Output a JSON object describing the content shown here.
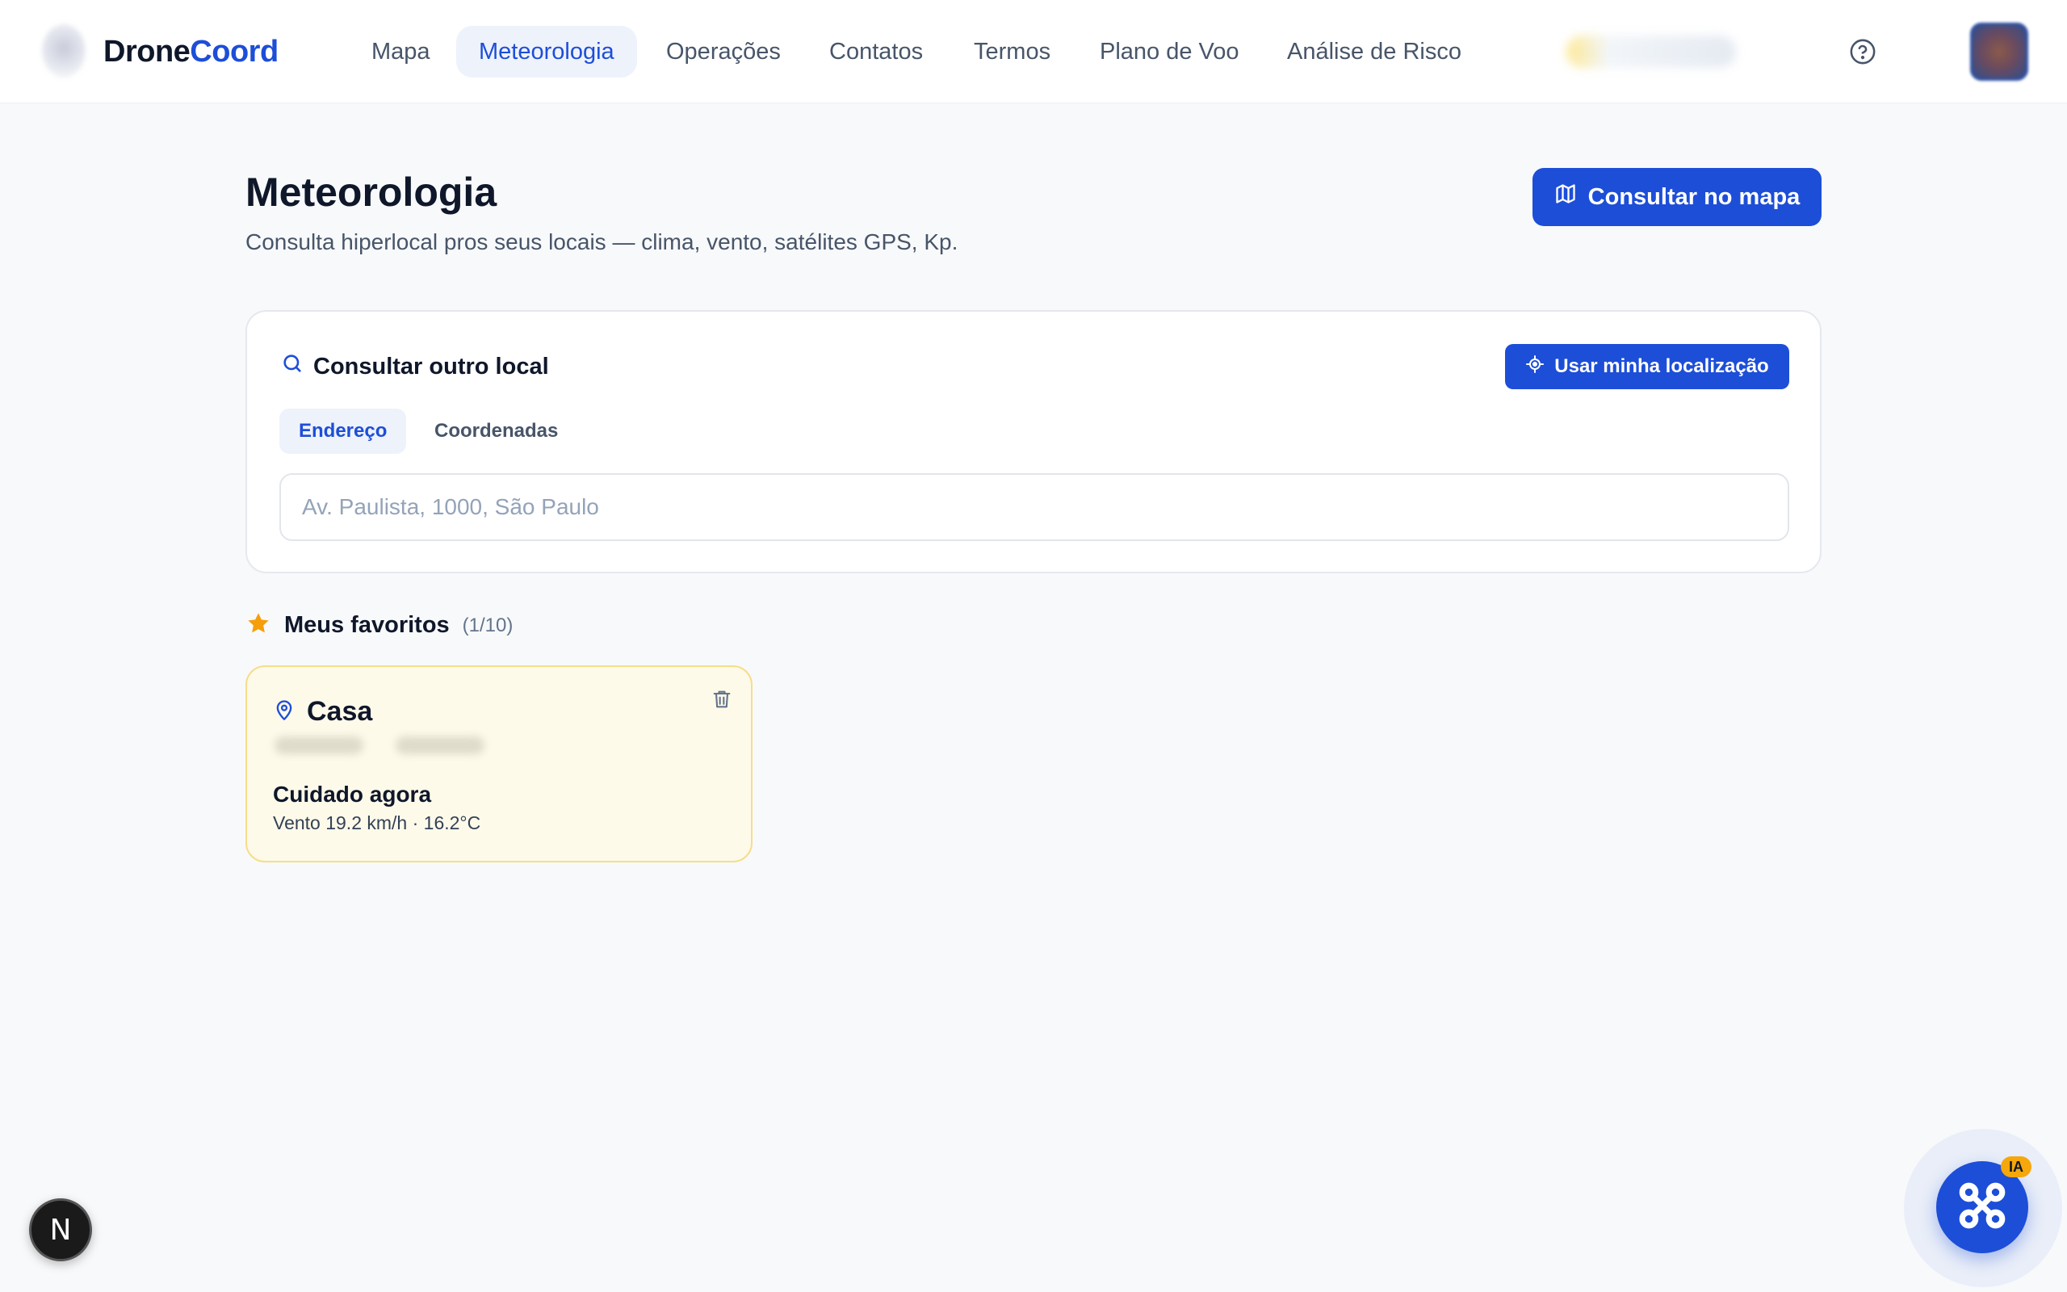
{
  "brand": {
    "part1": "Drone",
    "part2": "Coord"
  },
  "nav": {
    "items": [
      {
        "label": "Mapa"
      },
      {
        "label": "Meteorologia",
        "active": true
      },
      {
        "label": "Operações"
      },
      {
        "label": "Contatos"
      },
      {
        "label": "Termos"
      },
      {
        "label": "Plano de Voo"
      },
      {
        "label": "Análise de Risco"
      }
    ],
    "help_icon": "help-circle-icon"
  },
  "page": {
    "title": "Meteorologia",
    "subtitle": "Consulta hiperlocal pros seus locais — clima, vento, satélites GPS, Kp.",
    "map_button_label": "Consultar no mapa"
  },
  "search": {
    "title": "Consultar outro local",
    "locate_button_label": "Usar minha localização",
    "tabs": [
      {
        "label": "Endereço",
        "active": true
      },
      {
        "label": "Coordenadas"
      }
    ],
    "placeholder": "Av. Paulista, 1000, São Paulo",
    "value": ""
  },
  "favorites": {
    "title": "Meus favoritos",
    "count": "(1/10)",
    "items": [
      {
        "name": "Casa",
        "status": "Cuidado agora",
        "meta": "Vento 19.2 km/h · 16.2°C"
      }
    ]
  },
  "floating": {
    "n_badge": "N",
    "ai_tag": "IA"
  },
  "colors": {
    "accent": "#1d4ed8",
    "background": "#f8f9fb",
    "warning_card": "#fefaea",
    "warning_border": "#f6dd8a",
    "star": "#f59e0b"
  }
}
